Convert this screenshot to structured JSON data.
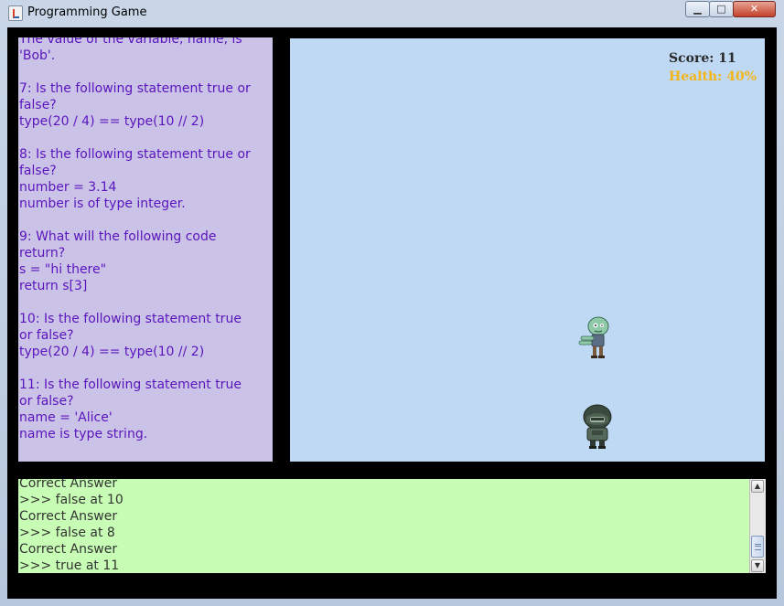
{
  "window": {
    "title": "Programming Game",
    "icon": "java-cup-icon",
    "minimize_glyph": "▁",
    "maximize_glyph": "□",
    "close_glyph": "✕"
  },
  "questions": {
    "text": "The value of the variable, name, is\n'Bob'.\n\n7: Is the following statement true or\nfalse?\ntype(20 / 4) == type(10 // 2)\n\n8: Is the following statement true or\nfalse?\nnumber = 3.14\nnumber is of type integer.\n\n9: What will the following code\nreturn?\ns = \"hi there\"\nreturn s[3]\n\n10: Is the following statement true\nor false?\ntype(20 / 4) == type(10 // 2)\n\n11: Is the following statement true\nor false?\nname = 'Alice'\nname is type string."
  },
  "hud": {
    "score": "Score: 11",
    "health": "Health: 40%",
    "health_color": "#f2b51a"
  },
  "console": {
    "text": "Correct Answer\n>>> false at 10\nCorrect Answer\n>>> false at 8\nCorrect Answer\n>>> true at 11"
  },
  "colors": {
    "question_bg": "#cbc3e7",
    "question_text": "#5a14bd",
    "game_bg": "#bfd9f4",
    "console_bg": "#c7fdb4"
  },
  "scrollbar": {
    "up_glyph": "▲",
    "down_glyph": "▼"
  }
}
